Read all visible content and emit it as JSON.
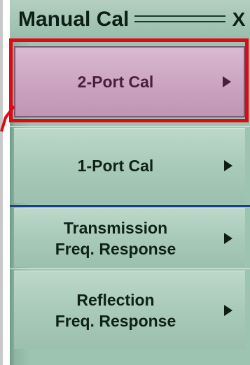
{
  "panel": {
    "title": "Manual Cal",
    "close_label": "X"
  },
  "menu": {
    "items": [
      {
        "label": "2-Port Cal",
        "active": true
      },
      {
        "label": "1-Port Cal",
        "active": false
      },
      {
        "label": "Transmission\nFreq. Response",
        "active": false
      },
      {
        "label": "Reflection\nFreq. Response",
        "active": false
      }
    ]
  },
  "colors": {
    "highlight": "#e30613",
    "active_button": "#caa2bf",
    "button": "#a9cab9",
    "separator": "#1d3f8a"
  },
  "icons": {
    "submenu": "triangle-right-icon"
  }
}
